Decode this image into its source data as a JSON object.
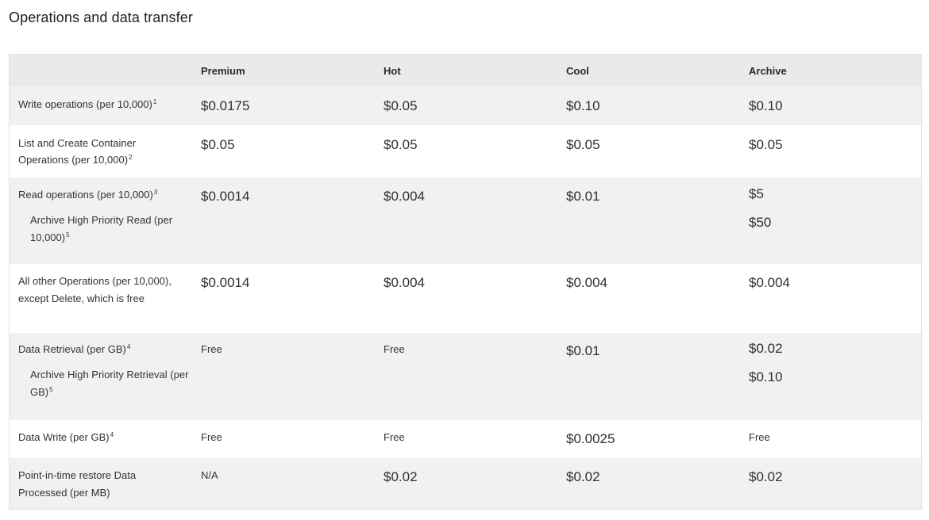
{
  "section_title": "Operations and data transfer",
  "headers": [
    "Premium",
    "Hot",
    "Cool",
    "Archive"
  ],
  "rows": [
    {
      "label": "Write operations (per 10,000)",
      "label_sup": "1",
      "values": [
        "$0.0175",
        "$0.05",
        "$0.10",
        "$0.10"
      ]
    },
    {
      "label": "List and Create Container Operations (per 10,000)",
      "label_sup": "2",
      "values": [
        "$0.05",
        "$0.05",
        "$0.05",
        "$0.05"
      ]
    },
    {
      "label": "Read operations (per 10,000)",
      "label_sup": "3",
      "sub_label": "Archive High Priority Read (per 10,000)",
      "sub_label_sup": "5",
      "values": [
        "$0.0014",
        "$0.004",
        "$0.01",
        "$5"
      ],
      "archive_sub_value": "$50"
    },
    {
      "label": "All other Operations (per 10,000), except Delete, which is free",
      "values": [
        "$0.0014",
        "$0.004",
        "$0.004",
        "$0.004"
      ]
    },
    {
      "label": "Data Retrieval (per GB)",
      "label_sup": "4",
      "sub_label": "Archive High Priority Retrieval (per GB)",
      "sub_label_sup": "5",
      "values": [
        "Free",
        "Free",
        "$0.01",
        "$0.02"
      ],
      "archive_sub_value": "$0.10"
    },
    {
      "label": "Data Write (per GB)",
      "label_sup": "4",
      "values": [
        "Free",
        "Free",
        "$0.0025",
        "Free"
      ]
    },
    {
      "label": "Point-in-time restore Data Processed (per MB)",
      "values": [
        "N/A",
        "$0.02",
        "$0.02",
        "$0.02"
      ]
    }
  ]
}
